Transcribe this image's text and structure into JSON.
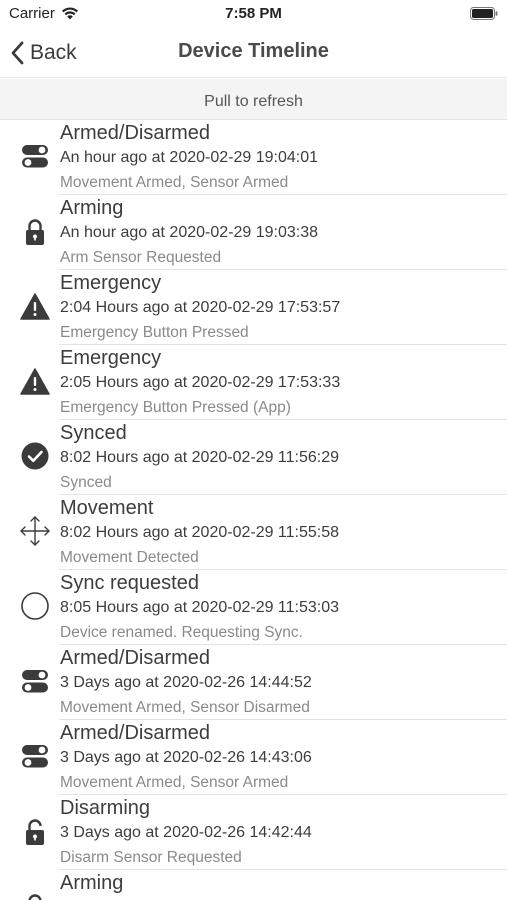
{
  "status_bar": {
    "carrier": "Carrier",
    "time": "7:58 PM"
  },
  "nav": {
    "back_label": "Back",
    "title": "Device Timeline"
  },
  "refresh": {
    "label": "Pull to refresh"
  },
  "events": [
    {
      "icon": "toggle-switch-icon",
      "title": "Armed/Disarmed",
      "time": "An hour ago at 2020-02-29 19:04:01",
      "detail": "Movement Armed, Sensor Armed"
    },
    {
      "icon": "lock-icon",
      "title": "Arming",
      "time": "An hour ago at 2020-02-29 19:03:38",
      "detail": "Arm Sensor Requested"
    },
    {
      "icon": "warning-triangle-icon",
      "title": "Emergency",
      "time": "2:04 Hours ago at 2020-02-29 17:53:57",
      "detail": "Emergency Button Pressed"
    },
    {
      "icon": "warning-triangle-icon",
      "title": "Emergency",
      "time": "2:05 Hours ago at 2020-02-29 17:53:33",
      "detail": "Emergency Button Pressed (App)"
    },
    {
      "icon": "checkmark-circle-icon",
      "title": "Synced",
      "time": "8:02 Hours ago at 2020-02-29 11:56:29",
      "detail": "Synced"
    },
    {
      "icon": "move-arrows-icon",
      "title": "Movement",
      "time": "8:02 Hours ago at 2020-02-29 11:55:58",
      "detail": "Movement Detected"
    },
    {
      "icon": "empty-circle-icon",
      "title": "Sync requested",
      "time": "8:05 Hours ago at 2020-02-29 11:53:03",
      "detail": "Device renamed. Requesting Sync."
    },
    {
      "icon": "toggle-switch-icon",
      "title": "Armed/Disarmed",
      "time": "3 Days ago at 2020-02-26 14:44:52",
      "detail": "Movement Armed, Sensor Disarmed"
    },
    {
      "icon": "toggle-switch-icon",
      "title": "Armed/Disarmed",
      "time": "3 Days ago at 2020-02-26 14:43:06",
      "detail": "Movement Armed, Sensor Armed"
    },
    {
      "icon": "unlock-icon",
      "title": "Disarming",
      "time": "3 Days ago at 2020-02-26 14:42:44",
      "detail": "Disarm Sensor Requested"
    },
    {
      "icon": "lock-icon",
      "title": "Arming",
      "time": "",
      "detail": ""
    }
  ]
}
